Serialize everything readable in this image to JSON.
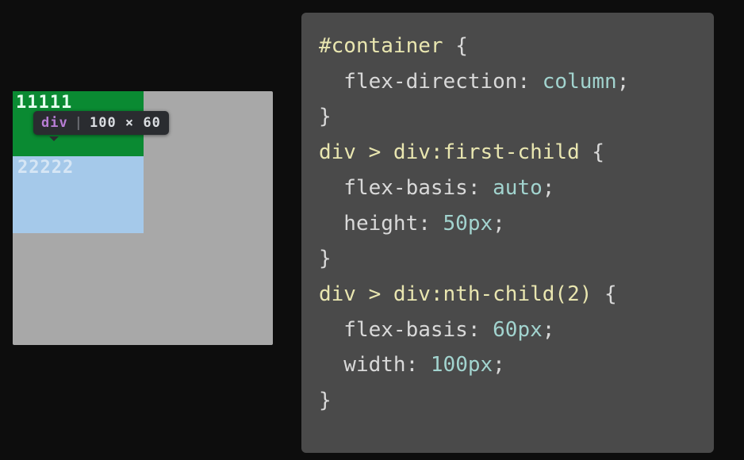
{
  "preview": {
    "box1_label": "11111",
    "box2_label": "22222",
    "tooltip": {
      "tag": "div",
      "dimensions": "100 × 60"
    }
  },
  "css": {
    "rules": [
      {
        "selector": "#container",
        "declarations": [
          {
            "property": "flex-direction",
            "value": "column"
          }
        ]
      },
      {
        "selector": "div > div:first-child",
        "declarations": [
          {
            "property": "flex-basis",
            "value": "auto"
          },
          {
            "property": "height",
            "value": "50px"
          }
        ]
      },
      {
        "selector": "div > div:nth-child(2)",
        "declarations": [
          {
            "property": "flex-basis",
            "value": "60px"
          },
          {
            "property": "width",
            "value": "100px"
          }
        ]
      }
    ]
  }
}
